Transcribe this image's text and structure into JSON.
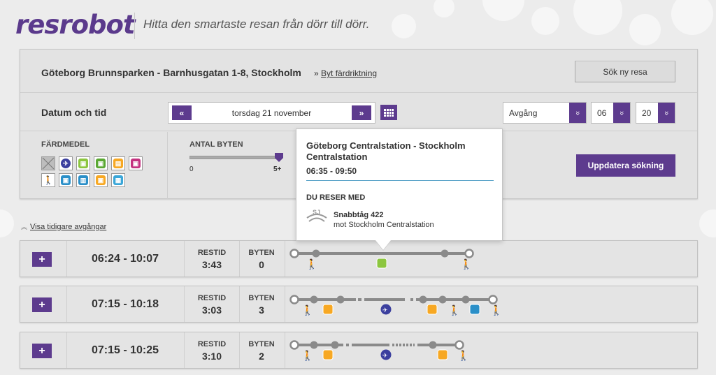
{
  "header": {
    "logo": "resrobot",
    "tagline": "Hitta den smartaste resan från dörr till dörr."
  },
  "search": {
    "route": "Göteborg Brunnsparken - Barnhusgatan 1-8, Stockholm",
    "switch_prefix": "»",
    "switch_label": "Byt färdriktning",
    "new_search": "Sök ny resa",
    "date_label": "Datum och tid",
    "date_prev": "«",
    "date_value": "torsdag 21 november",
    "date_next": "»",
    "dep_select": "Avgång",
    "hour_select": "06",
    "minute_select": "20",
    "chevron": "»",
    "modes_label": "FÄRDMEDEL",
    "changes_label": "ANTAL BYTEN",
    "changes_min": "0",
    "changes_max": "5+",
    "changes_level": 1.0,
    "update": "Uppdatera sökning"
  },
  "earlier_link": "Visa tidigare avgångar",
  "trips": [
    {
      "expand": "+",
      "time": "06:24 - 10:07",
      "duration_label": "RESTID",
      "duration": "3:43",
      "changes_label": "BYTEN",
      "changes": "0"
    },
    {
      "expand": "+",
      "time": "07:15 - 10:18",
      "duration_label": "RESTID",
      "duration": "3:03",
      "changes_label": "BYTEN",
      "changes": "3"
    },
    {
      "expand": "+",
      "time": "07:15 - 10:25",
      "duration_label": "RESTID",
      "duration": "3:10",
      "changes_label": "BYTEN",
      "changes": "2"
    }
  ],
  "popup": {
    "title": "Göteborg Centralstation - Stockholm Centralstation",
    "time": "06:35 - 09:50",
    "subtitle": "DU RESER MED",
    "operator_logo": "SJ",
    "train": "Snabbtåg 422",
    "direction": "mot Stockholm Centralstation"
  },
  "colors": {
    "brand": "#5d3b8e",
    "train_green": "#8cc63f",
    "bus_orange": "#f7a823",
    "flight_blue": "#3b3f9e",
    "metro_blue": "#2a8fc8",
    "ferry_magenta": "#c4317f"
  },
  "mode_icons": [
    "all-modes-icon",
    "flight-icon",
    "regional-train-icon",
    "train-icon",
    "bus-icon",
    "ferry-icon",
    "walk-icon",
    "metro-icon",
    "tram-icon",
    "local-bus-icon",
    "commuter-train-icon"
  ]
}
